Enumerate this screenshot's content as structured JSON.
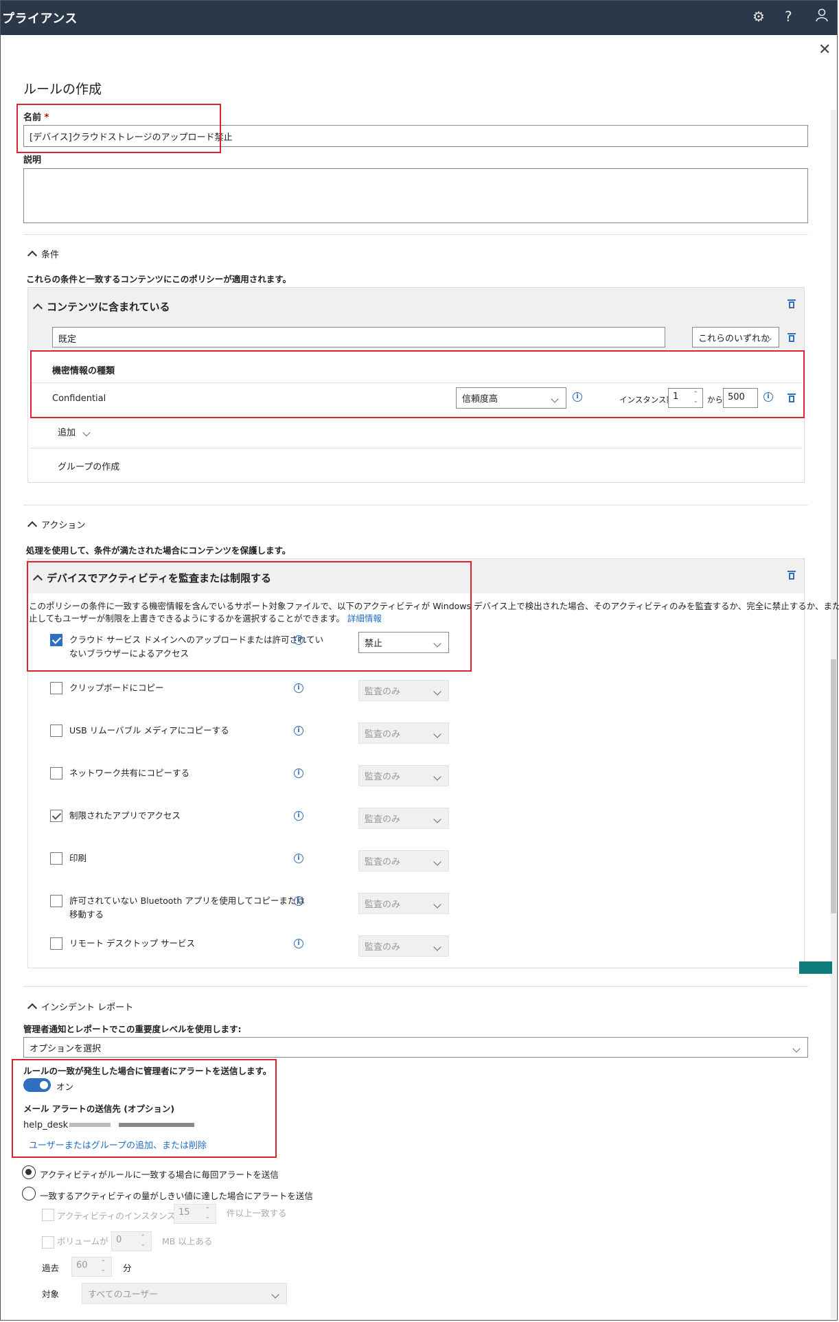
{
  "header": {
    "title": "プライアンス",
    "settings_icon": "gear-icon",
    "help_label": "?",
    "user_icon": "person-icon"
  },
  "page": {
    "title": "ルールの作成",
    "close_icon": "close-icon"
  },
  "form": {
    "name_label": "名前",
    "name_required": "*",
    "name_value": "[デバイス]クラウドストレージのアップロード禁止",
    "description_label": "説明",
    "description_value": ""
  },
  "conditions": {
    "header": "条件",
    "description": "これらの条件と一致するコンテンツにこのポリシーが適用されます。",
    "group_title": "コンテンツに含まれている",
    "group_name_value": "既定",
    "match_select": "これらのいずれか",
    "sit_header": "機密情報の種類",
    "sit_name": "Confidential",
    "confidence_select": "信頼度高",
    "instance_label": "インスタンス数",
    "instance_min": "1",
    "from_label": "から",
    "instance_max": "500",
    "add_label": "追加",
    "create_group_label": "グループの作成"
  },
  "actions": {
    "header": "アクション",
    "description": "処理を使用して、条件が満たされた場合にコンテンツを保護します。",
    "panel_title": "デバイスでアクティビティを監査または制限する",
    "panel_desc_line1": "このポリシーの条件に一致する機密情報を含んでいるサポート対象ファイルで、以下のアクティビティが Windows デバイス上で検出された場合、そのアクティビティのみを監査するか、完全に禁止するか、または禁",
    "panel_desc_line2": "止してもユーザーが制限を上書きできるようにするかを選択することができます。",
    "learn_more": "詳細情報",
    "items": [
      {
        "label1": "クラウド サービス ドメインへのアップロードまたは許可されてい",
        "label2": "ないブラウザーによるアクセス",
        "value": "禁止",
        "checked": "blue"
      },
      {
        "label1": "クリップボードにコピー",
        "label2": "",
        "value": "監査のみ",
        "checked": "none"
      },
      {
        "label1": "USB リムーバブル メディアにコピーする",
        "label2": "",
        "value": "監査のみ",
        "checked": "none"
      },
      {
        "label1": "ネットワーク共有にコピーする",
        "label2": "",
        "value": "監査のみ",
        "checked": "none"
      },
      {
        "label1": "制限されたアプリでアクセス",
        "label2": "",
        "value": "監査のみ",
        "checked": "grey"
      },
      {
        "label1": "印刷",
        "label2": "",
        "value": "監査のみ",
        "checked": "none"
      },
      {
        "label1": "許可されていない Bluetooth アプリを使用してコピーまたは",
        "label2": "移動する",
        "value": "監査のみ",
        "checked": "none"
      },
      {
        "label1": "リモート デスクトップ サービス",
        "label2": "",
        "value": "監査のみ",
        "checked": "none"
      }
    ]
  },
  "incident": {
    "header": "インシデント レポート",
    "severity_label": "管理者通知とレポートでこの重要度レベルを使用します:",
    "severity_value": "オプションを選択",
    "alert_label": "ルールの一致が発生した場合に管理者にアラートを送信します。",
    "toggle_value": "オン",
    "email_label": "メール アラートの送信先 (オプション)",
    "email_value": "help_desk",
    "add_remove_link": "ユーザーまたはグループの追加、または削除",
    "radio_every": "アクティビティがルールに一致する場合に毎回アラートを送信",
    "radio_threshold": "一致するアクティビティの量がしきい値に達した場合にアラートを送信",
    "inst_label": "アクティビティのインスタンスが",
    "inst_value": "15",
    "inst_suffix": "件以上一致する",
    "vol_label": "ボリュームが",
    "vol_value": "0",
    "vol_suffix": "MB 以上ある",
    "past_label": "過去",
    "past_value": "60",
    "past_unit": "分",
    "target_label": "対象",
    "target_value": "すべてのユーザー"
  }
}
